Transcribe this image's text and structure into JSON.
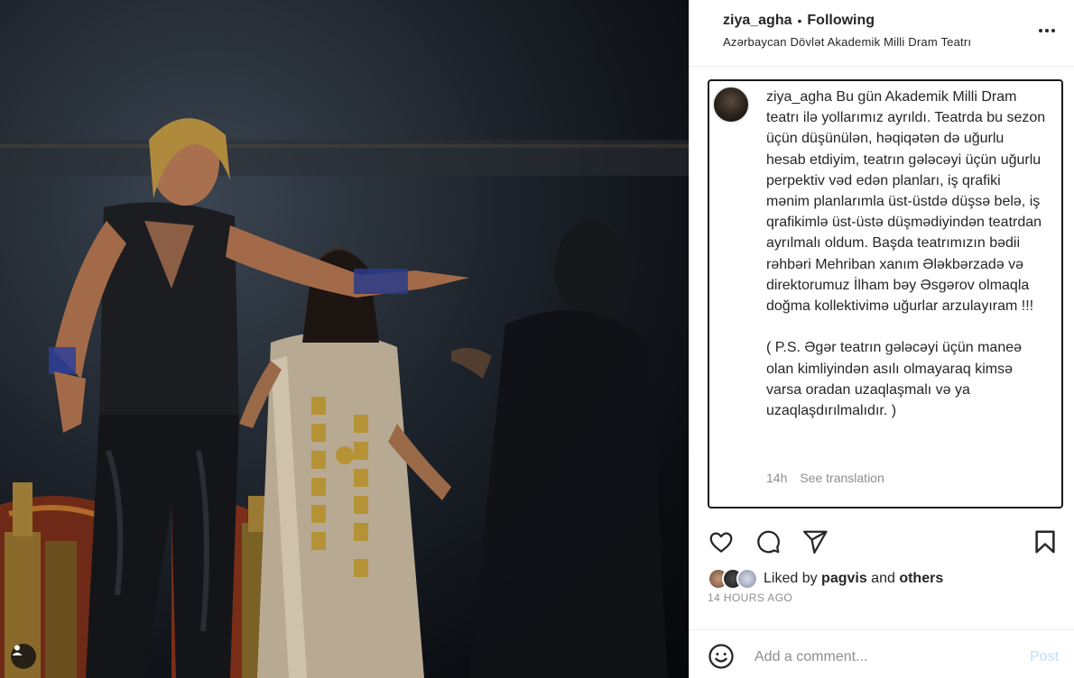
{
  "post": {
    "author": "ziya_agha",
    "separator": "•",
    "follow_status": "Following",
    "location": "Azərbaycan Dövlət Akademik Milli Dram Teatrı",
    "caption_author": "ziya_agha",
    "caption_text": " Bu gün Akademik Milli Dram teatrı ilə yollarımız ayrıldı. Teatrda bu sezon üçün düşünülən, həqiqətən də uğurlu hesab etdiyim, teatrın gələcəyi üçün uğurlu perpektiv vəd edən planları, iş qrafiki mənim planlarımla üst-üstdə düşsə belə, iş qrafikimlə üst-üstə düşmədiyindən teatrdan ayrılmalı oldum. Başda teatrımızın bədii rəhbəri Mehriban xanım Ələkbərzadə və direktorumuz İlham bəy Əsgərov olmaqla doğma kollektivimə uğurlar arzulayıram !!!\n\n( P.S. Əgər teatrın gələcəyi üçün maneə olan kimliyindən asılı olmayaraq kimsə varsa oradan uzaqlaşmalı və ya uzaqlaşdırılmalıdır. )",
    "caption_age": "14h",
    "see_translation": "See translation",
    "liked_by_prefix": "Liked by ",
    "liked_by_user": "pagvis",
    "liked_by_and": " and ",
    "liked_by_others": "others",
    "time_ago": "14 HOURS AGO"
  },
  "comment": {
    "placeholder": "Add a comment...",
    "post_label": "Post"
  },
  "icons": {
    "more": "more-options-icon",
    "like": "heart-icon",
    "comment": "comment-bubble-icon",
    "share": "paper-plane-icon",
    "save": "bookmark-icon",
    "emoji": "smiley-icon",
    "tag": "user-tag-icon"
  },
  "colors": {
    "text": "#262626",
    "secondary": "#8e8e8e",
    "post_disabled": "#c0dffd",
    "border": "#dbdbdb"
  }
}
